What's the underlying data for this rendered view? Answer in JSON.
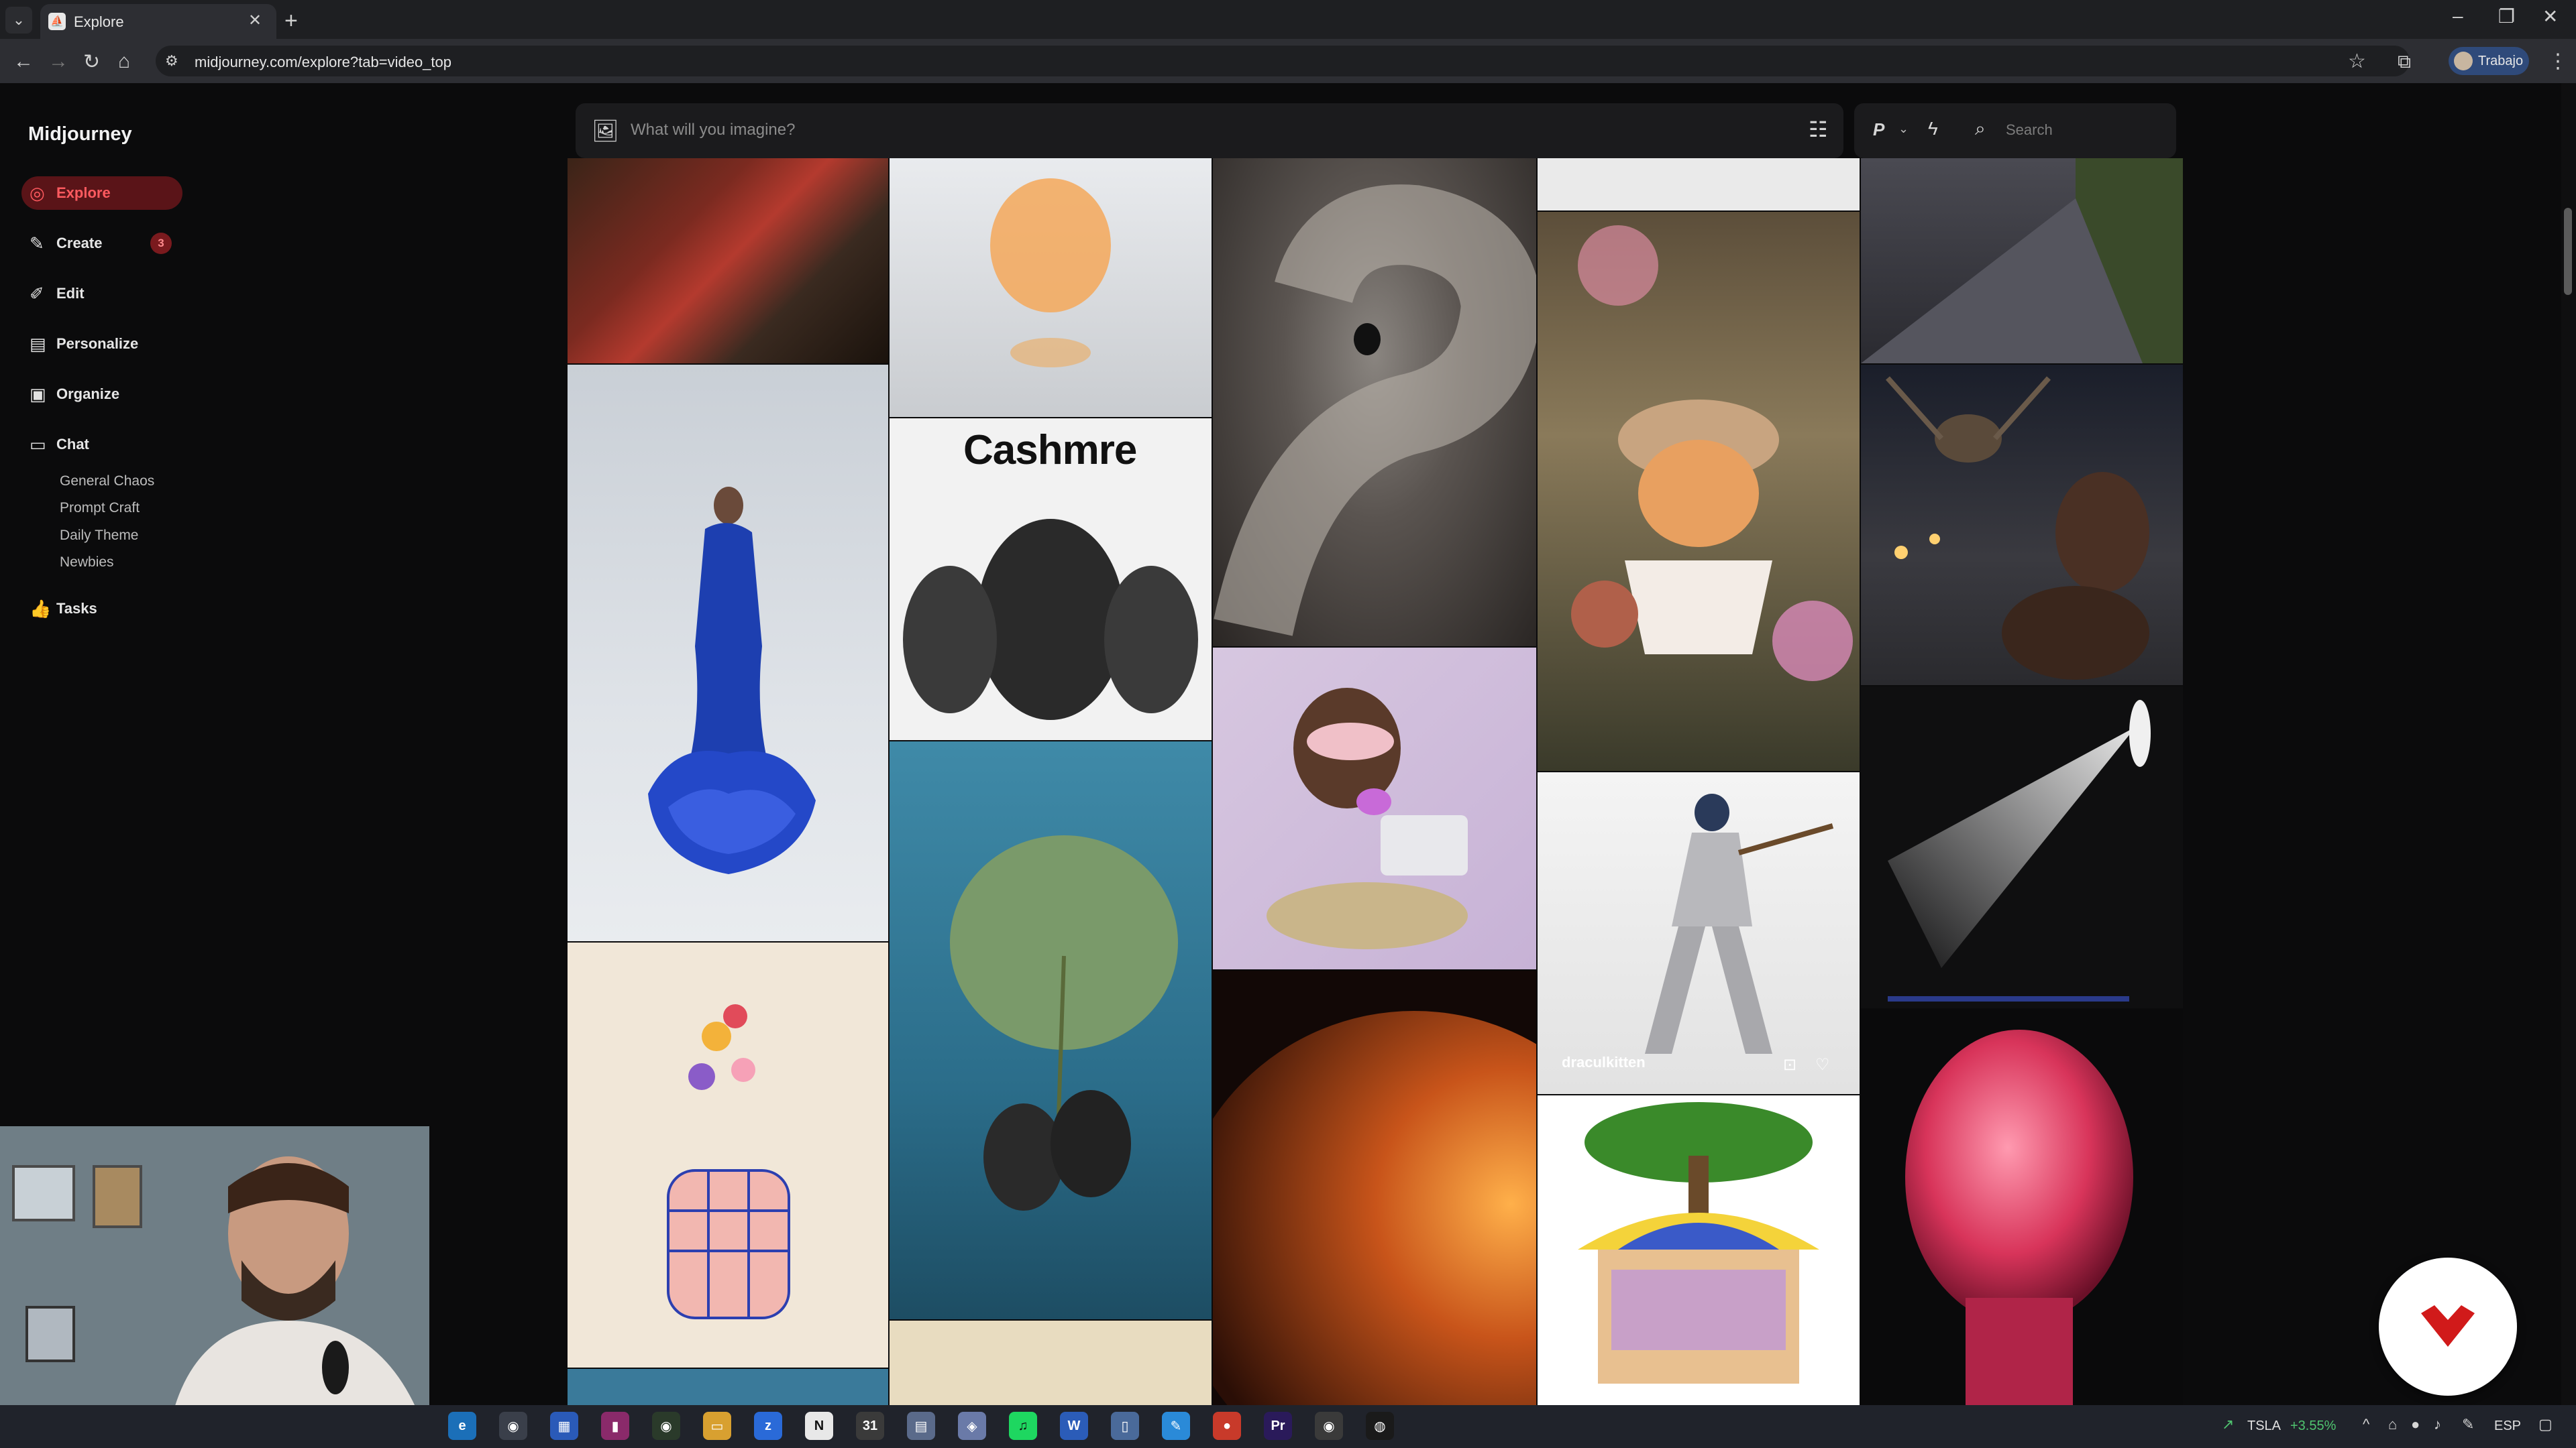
{
  "browser": {
    "tab_title": "Explore",
    "url": "midjourney.com/explore?tab=video_top",
    "profile_name": "Trabajo"
  },
  "sidebar": {
    "brand": "Midjourney",
    "items": [
      {
        "label": "Explore",
        "icon": "compass-icon",
        "active": true
      },
      {
        "label": "Create",
        "icon": "brush-icon",
        "badge": "3"
      },
      {
        "label": "Edit",
        "icon": "pencil-icon"
      },
      {
        "label": "Personalize",
        "icon": "personalize-icon"
      },
      {
        "label": "Organize",
        "icon": "image-stack-icon"
      },
      {
        "label": "Chat",
        "icon": "chat-icon"
      },
      {
        "label": "Tasks",
        "icon": "thumbs-up-icon"
      }
    ],
    "chat_rooms": [
      "General Chaos",
      "Prompt Craft",
      "Daily Theme",
      "Newbies"
    ]
  },
  "prompt": {
    "placeholder": "What will you imagine?"
  },
  "toolbar": {
    "personalize_label": "P",
    "search_placeholder": "Search"
  },
  "gallery": {
    "cashmre_title": "Cashmre",
    "hovered_author": "draculkitten"
  },
  "taskbar": {
    "ticker": "TSLA",
    "ticker_change": "+3.55%",
    "lang": "ESP"
  },
  "colors": {
    "accent": "#ff5a5f",
    "accent_bg": "#5a1418",
    "background": "#0b0b0c"
  }
}
